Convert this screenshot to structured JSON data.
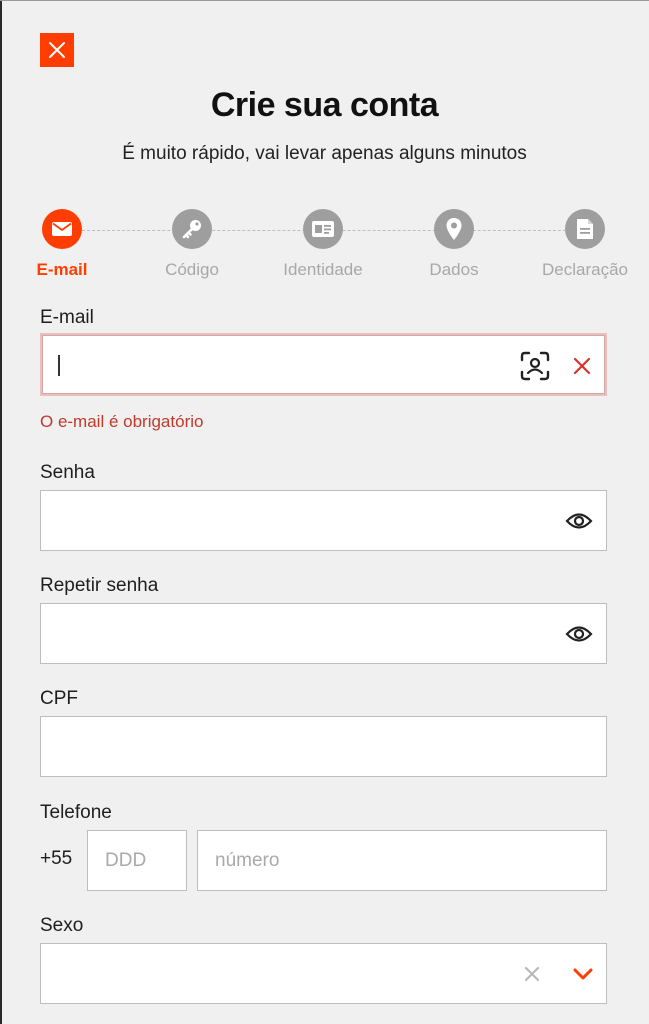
{
  "header": {
    "close_icon": "close-icon",
    "title": "Crie sua conta",
    "subtitle": "É muito rápido, vai levar apenas alguns minutos"
  },
  "stepper": {
    "steps": [
      {
        "label": "E-mail",
        "icon": "envelope-icon",
        "active": true
      },
      {
        "label": "Código",
        "icon": "key-icon",
        "active": false
      },
      {
        "label": "Identidade",
        "icon": "id-card-icon",
        "active": false
      },
      {
        "label": "Dados",
        "icon": "map-pin-icon",
        "active": false
      },
      {
        "label": "Declaração",
        "icon": "document-icon",
        "active": false
      }
    ]
  },
  "form": {
    "email": {
      "label": "E-mail",
      "value": "",
      "error": "O e-mail é obrigatório"
    },
    "senha": {
      "label": "Senha",
      "value": ""
    },
    "repetir_senha": {
      "label": "Repetir senha",
      "value": ""
    },
    "cpf": {
      "label": "CPF",
      "value": ""
    },
    "telefone": {
      "label": "Telefone",
      "prefix": "+55",
      "ddd_placeholder": "DDD",
      "numero_placeholder": "número"
    },
    "sexo": {
      "label": "Sexo",
      "value": ""
    }
  },
  "colors": {
    "accent": "#ff3d00",
    "error": "#c0392b",
    "step_inactive": "#9e9e9e"
  }
}
